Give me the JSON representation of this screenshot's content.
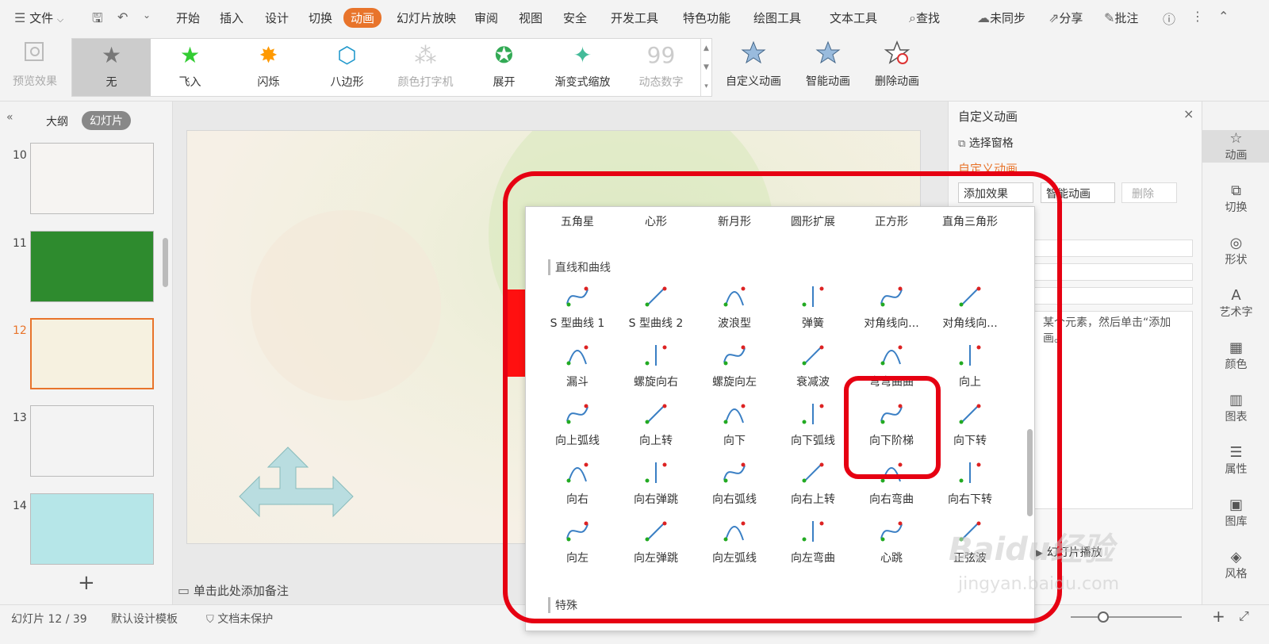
{
  "menu": {
    "file": "文件",
    "items": [
      "开始",
      "插入",
      "设计",
      "切换",
      "动画",
      "幻灯片放映",
      "审阅",
      "视图",
      "安全",
      "开发工具",
      "特色功能",
      "绘图工具",
      "文本工具"
    ],
    "active": "动画",
    "search": "查找",
    "sync": "未同步",
    "share": "分享",
    "comment": "批注"
  },
  "ribbon": {
    "preview": "预览效果",
    "gallery": [
      {
        "label": "无"
      },
      {
        "label": "飞入"
      },
      {
        "label": "闪烁"
      },
      {
        "label": "八边形"
      },
      {
        "label": "颜色打字机"
      },
      {
        "label": "展开"
      },
      {
        "label": "渐变式缩放"
      },
      {
        "label": "动态数字"
      }
    ],
    "custom_anim": "自定义动画",
    "smart_anim": "智能动画",
    "delete_anim": "删除动画"
  },
  "left": {
    "tab_outline": "大纲",
    "tab_slides": "幻灯片",
    "slides": [
      {
        "num": "10"
      },
      {
        "num": "11"
      },
      {
        "num": "12"
      },
      {
        "num": "13"
      },
      {
        "num": "14"
      }
    ],
    "add": "+"
  },
  "notes": "单击此处添加备注",
  "right": {
    "title": "自定义动画",
    "select_pane": "选择窗格",
    "section": "自定义动画",
    "add_effect": "添加效果",
    "smart_anim": "智能动画",
    "delete": "删除",
    "hint": "某个元素，然后单击“添加画。",
    "play": "幻灯片播放"
  },
  "rightbar": [
    "动画",
    "切换",
    "形状",
    "艺术字",
    "颜色",
    "图表",
    "属性",
    "图库",
    "风格"
  ],
  "status": {
    "slide": "幻灯片 12 / 39",
    "template": "默认设计模板",
    "protect": "文档未保护"
  },
  "popup": {
    "top_row": [
      "五角星",
      "心形",
      "新月形",
      "圆形扩展",
      "正方形",
      "直角三角形"
    ],
    "section1": "直线和曲线",
    "rows": [
      [
        "S 型曲线 1",
        "S 型曲线 2",
        "波浪型",
        "弹簧",
        "对角线向...",
        "对角线向..."
      ],
      [
        "漏斗",
        "螺旋向右",
        "螺旋向左",
        "衰减波",
        "弯弯曲曲",
        "向上"
      ],
      [
        "向上弧线",
        "向上转",
        "向下",
        "向下弧线",
        "向下阶梯",
        "向下转"
      ],
      [
        "向右",
        "向右弹跳",
        "向右弧线",
        "向右上转",
        "向右弯曲",
        "向右下转"
      ],
      [
        "向左",
        "向左弹跳",
        "向左弧线",
        "向左弯曲",
        "心跳",
        "正弦波"
      ]
    ],
    "section2": "特殊"
  },
  "watermark": {
    "brand": "Baidu经验",
    "url": "jingyan.baidu.com"
  },
  "colors": {
    "accent": "#e8742b",
    "highlight": "#e60012"
  }
}
